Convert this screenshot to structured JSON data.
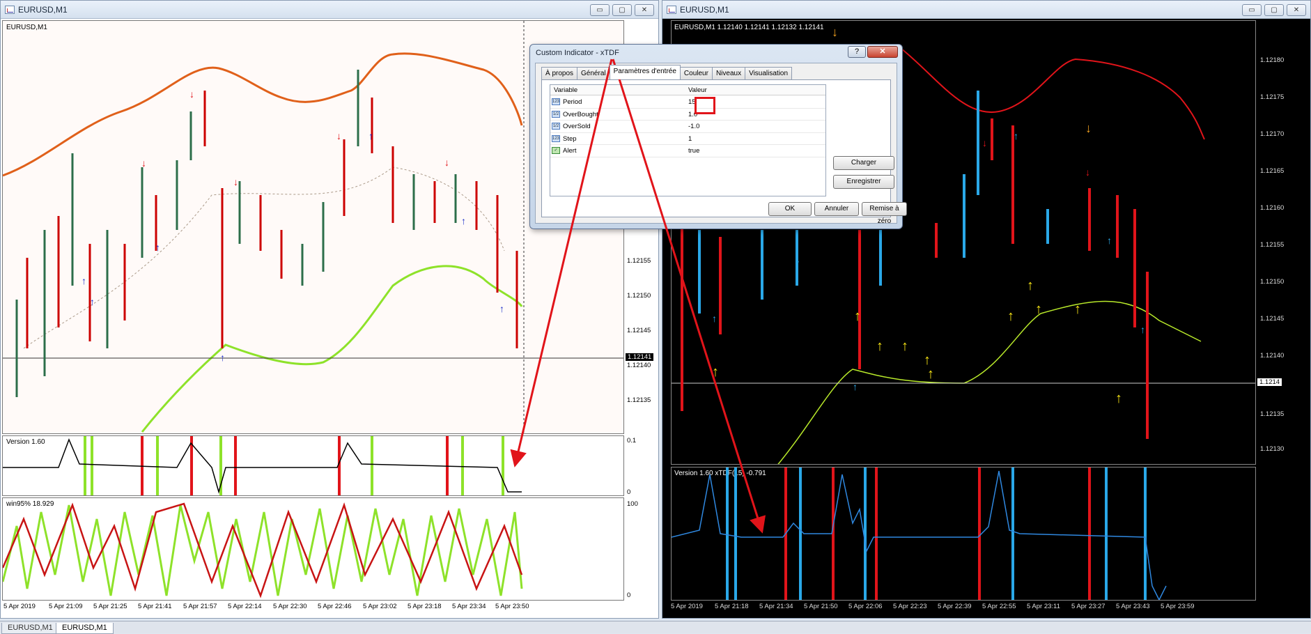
{
  "left_window": {
    "title": "EURUSD,M1",
    "chart_label": "EURUSD,M1",
    "price_ticks": [
      "1.12155",
      "1.12150",
      "1.12145",
      "1.12140",
      "1.12135"
    ],
    "current_price": "1.12141",
    "sub1_label": "Version 1.60",
    "sub1_ticks": [
      "0.1",
      "0"
    ],
    "sub2_label": "win95% 18.929",
    "sub2_ticks": [
      "100",
      "0"
    ],
    "time_ticks": [
      "5 Apr 2019",
      "5 Apr 21:09",
      "5 Apr 21:25",
      "5 Apr 21:41",
      "5 Apr 21:57",
      "5 Apr 22:14",
      "5 Apr 22:30",
      "5 Apr 22:46",
      "5 Apr 23:02",
      "5 Apr 23:18",
      "5 Apr 23:34",
      "5 Apr 23:50"
    ],
    "buttons": {
      "min": "▭",
      "max": "▢",
      "close": "✕"
    }
  },
  "right_window": {
    "title": "EURUSD,M1",
    "chart_label": "EURUSD,M1  1.12140 1.12141 1.12132 1.12141",
    "price_ticks": [
      "1.12180",
      "1.12175",
      "1.12170",
      "1.12165",
      "1.12160",
      "1.12155",
      "1.12150",
      "1.12145",
      "1.12140",
      "1.12135",
      "1.12130"
    ],
    "current_price": "1.1214",
    "sub_label": "Version 1.60  xTDF(15) -0.791",
    "time_ticks": [
      "5 Apr 2019",
      "5 Apr 21:18",
      "5 Apr 21:34",
      "5 Apr 21:50",
      "5 Apr 22:06",
      "5 Apr 22:23",
      "5 Apr 22:39",
      "5 Apr 22:55",
      "5 Apr 23:11",
      "5 Apr 23:27",
      "5 Apr 23:43",
      "5 Apr 23:59"
    ],
    "buttons": {
      "min": "▭",
      "max": "▢",
      "close": "✕"
    }
  },
  "dialog": {
    "title": "Custom Indicator - xTDF",
    "help": "?",
    "close": "✕",
    "tabs": [
      "À propos",
      "Général",
      "Paramètres d'entrée",
      "Couleur",
      "Niveaux",
      "Visualisation"
    ],
    "active_tab": 2,
    "col_variable": "Variable",
    "col_value": "Valeur",
    "params": [
      {
        "name": "Period",
        "value": "15",
        "icon": "123"
      },
      {
        "name": "OverBought",
        "value": "1.0",
        "icon": "1/2"
      },
      {
        "name": "OverSold",
        "value": "-1.0",
        "icon": "1/2"
      },
      {
        "name": "Step",
        "value": "1",
        "icon": "123"
      },
      {
        "name": "Alert",
        "value": "true",
        "icon": "✓"
      }
    ],
    "btn_load": "Charger",
    "btn_save": "Enregistrer",
    "btn_ok": "OK",
    "btn_cancel": "Annuler",
    "btn_reset": "Remise à zéro"
  },
  "bottom_tabs": [
    "EURUSD,M1",
    "EURUSD,M1"
  ],
  "colors": {
    "accent_red": "#e1141a",
    "green": "#8ee22a",
    "orange": "#e0601a",
    "cyan": "#2aa8e8",
    "yellow": "#f7e415"
  }
}
